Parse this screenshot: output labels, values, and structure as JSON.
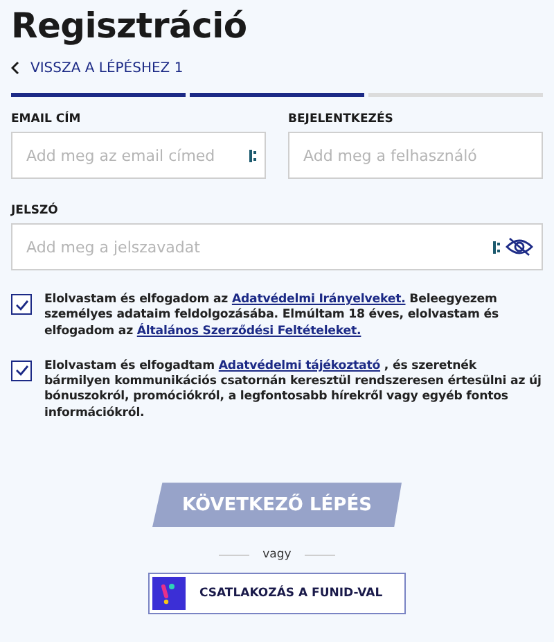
{
  "title": "Regisztráció",
  "back_link": "VISSZA A LÉPÉSHEZ 1",
  "progress_steps": [
    {
      "completed": true
    },
    {
      "completed": true
    },
    {
      "completed": false
    }
  ],
  "fields": [
    {
      "label": "EMAIL CÍM",
      "placeholder": "Add meg az email címed",
      "kind": "text"
    },
    {
      "label": "BEJELENTKEZÉS",
      "placeholder": "Add meg a felhasználó",
      "kind": "plain"
    },
    {
      "label": "JELSZÓ",
      "placeholder": "Add meg a jelszavadat",
      "kind": "password"
    }
  ],
  "consents": [
    {
      "checked": true,
      "parts": [
        {
          "kind": "text",
          "text": "Elolvastam és elfogadom az "
        },
        {
          "kind": "link",
          "text": "Adatvédelmi Irányelveket."
        },
        {
          "kind": "text",
          "text": " Beleegyezem személyes adataim feldolgozásába. Elmúltam 18 éves, elolvastam és elfogadom az "
        },
        {
          "kind": "link",
          "text": "Általános Szerződési Feltételeket."
        }
      ]
    },
    {
      "checked": true,
      "parts": [
        {
          "kind": "text",
          "text": "Elolvastam és elfogadtam "
        },
        {
          "kind": "link",
          "text": "Adatvédelmi tájékoztató"
        },
        {
          "kind": "text",
          "text": " , és szeretnék bármilyen kommunikációs csatornán keresztül rendszeresen értesülni az új bónuszokról, promóciókról, a legfontosabb hírekről vagy egyéb fontos információkról."
        }
      ]
    }
  ],
  "next_button": {
    "label": "KÖVETKEZŐ LÉPÉS",
    "disabled": true
  },
  "separator": "vagy",
  "funid_button": "CSATLAKOZÁS A FUNID-VAL"
}
